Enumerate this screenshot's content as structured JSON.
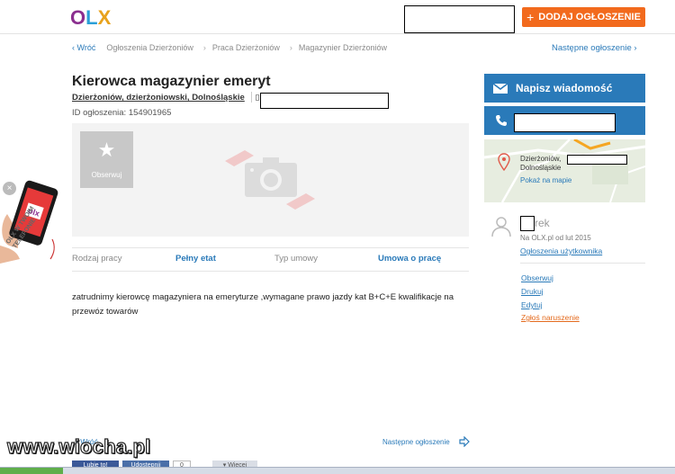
{
  "header": {
    "logo": {
      "o": "O",
      "l": "L",
      "x": "X"
    },
    "add_button": "DODAJ OGŁOSZENIE",
    "add_icon": "plus-icon"
  },
  "breadcrumb": {
    "back": "Wróć",
    "items": [
      "Ogłoszenia Dzierżoniów",
      "Praca Dzierżoniów",
      "Magazynier Dzierżoniów"
    ],
    "next": "Następne ogłoszenie"
  },
  "ad": {
    "title": "Kierowca magazynier emeryt",
    "location": "Dzierżoniów, dzierżoniowski, Dolnośląskie",
    "id": "ID ogłoszenia: 154901965",
    "observe": "Obserwuj",
    "params": [
      {
        "label": "Rodzaj pracy",
        "value": "Pełny etat"
      },
      {
        "label": "Typ umowy",
        "value": "Umowa o pracę"
      }
    ],
    "description": "zatrudnimy kierowcę magazyniera na emeryturze ,wymagane prawo jazdy kat B+C+E kwalifikacje na przewóz towarów"
  },
  "contact": {
    "message": "Napisz wiadomość",
    "map_city": "Dzierżoniów,",
    "map_region": "Dolnośląskie",
    "map_link": "Pokaż na mapie"
  },
  "user": {
    "name": "rek",
    "since": "Na OLX.pl od lut 2015",
    "ads_link": "Ogłoszenia użytkownika",
    "actions": [
      "Obserwuj",
      "Drukuj",
      "Edytuj"
    ],
    "report": "Zgłoś naruszenie"
  },
  "bottom": {
    "back": "Wróć",
    "next": "Następne ogłoszenie",
    "share_fb": "Lubię to!",
    "share_other": "Udostępnij",
    "share_count": "0",
    "share_more": "Więcej"
  },
  "promo": {
    "text": "OLX W TWOIM TELEFONIE",
    "close": "×"
  },
  "watermark": "www.wiocha.pl",
  "colors": {
    "accent": "#2a7ab9",
    "orange": "#f26a1d",
    "logo_purple": "#8b2f8f",
    "logo_blue": "#2a9fd8",
    "logo_orange": "#e8a21c"
  }
}
